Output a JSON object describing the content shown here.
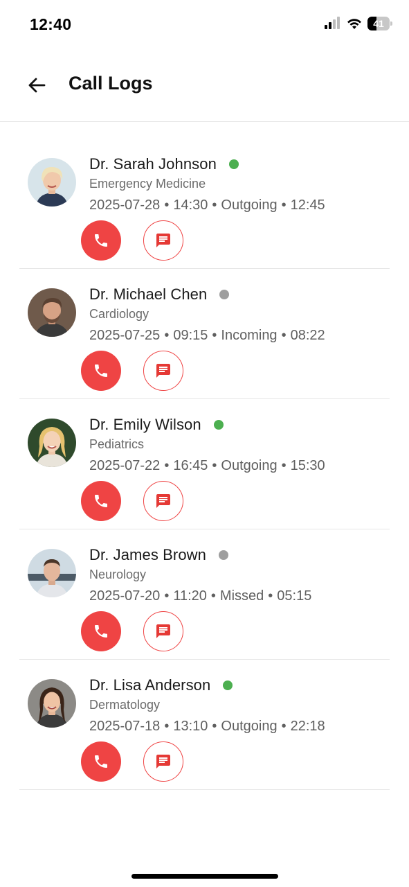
{
  "status_bar": {
    "time": "12:40",
    "battery_level": "41",
    "icons": [
      "signal-icon",
      "wifi-icon",
      "battery-icon"
    ]
  },
  "header": {
    "back_icon": "arrow-left-icon",
    "title": "Call Logs"
  },
  "colors": {
    "accent": "#ef4444",
    "online": "#4caf50",
    "offline": "#9e9e9e"
  },
  "calls": [
    {
      "name": "Dr. Sarah Johnson",
      "status": "online",
      "specialty": "Emergency Medicine",
      "date": "2025-07-28",
      "time": "14:30",
      "direction": "Outgoing",
      "duration": "12:45"
    },
    {
      "name": "Dr. Michael Chen",
      "status": "offline",
      "specialty": "Cardiology",
      "date": "2025-07-25",
      "time": "09:15",
      "direction": "Incoming",
      "duration": "08:22"
    },
    {
      "name": "Dr. Emily Wilson",
      "status": "online",
      "specialty": "Pediatrics",
      "date": "2025-07-22",
      "time": "16:45",
      "direction": "Outgoing",
      "duration": "15:30"
    },
    {
      "name": "Dr. James Brown",
      "status": "offline",
      "specialty": "Neurology",
      "date": "2025-07-20",
      "time": "11:20",
      "direction": "Missed",
      "duration": "05:15"
    },
    {
      "name": "Dr. Lisa Anderson",
      "status": "online",
      "specialty": "Dermatology",
      "date": "2025-07-18",
      "time": "13:10",
      "direction": "Outgoing",
      "duration": "22:18"
    }
  ],
  "meta_separator": "•"
}
